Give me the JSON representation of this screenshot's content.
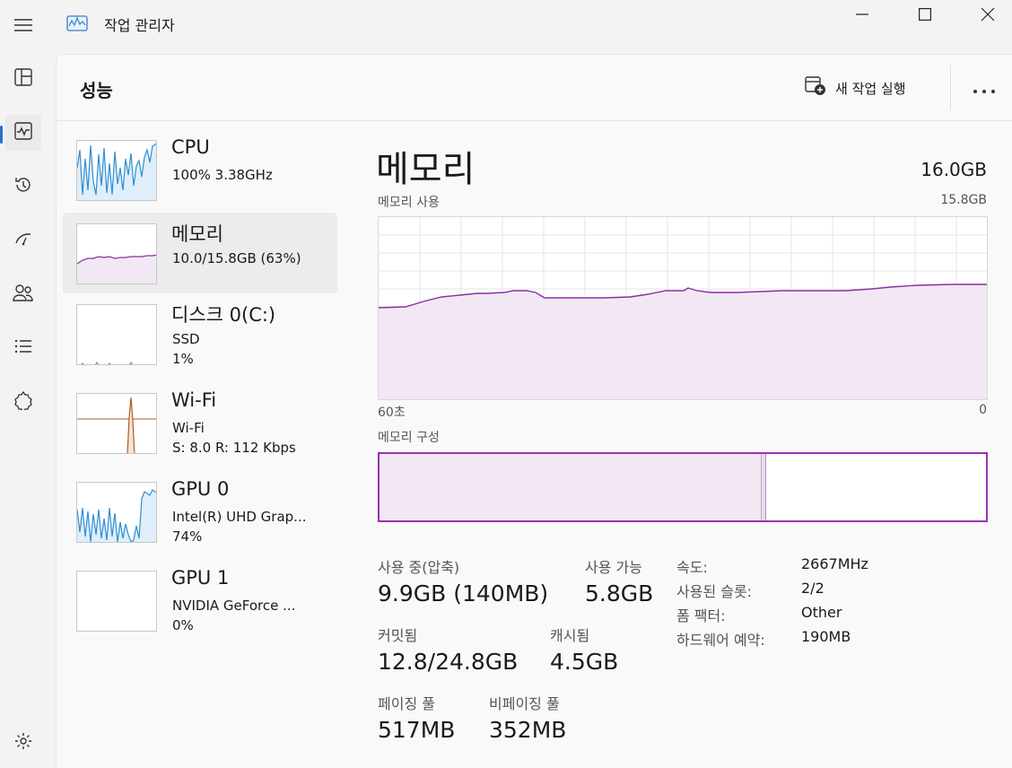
{
  "app": {
    "title": "작업 관리자"
  },
  "header": {
    "title": "성능",
    "new_task": "새 작업 실행"
  },
  "nav": {
    "icons": [
      "hamburger-icon",
      "processes-icon",
      "performance-icon",
      "app-history-icon",
      "startup-icon",
      "users-icon",
      "details-icon",
      "services-icon",
      "settings-icon"
    ]
  },
  "resources": [
    {
      "name": "CPU",
      "line1": "100% 3.38GHz",
      "line2": "",
      "line3": "",
      "color": "#2f8ed1"
    },
    {
      "name": "메모리",
      "line1": "10.0/15.8GB (63%)",
      "line2": "",
      "line3": "",
      "color": "#8b2f9e"
    },
    {
      "name": "디스크 0(C:)",
      "line1": "SSD",
      "line2": "1%",
      "line3": "",
      "color": "#5fb340"
    },
    {
      "name": "Wi-Fi",
      "line1": "Wi-Fi",
      "line2": "S: 8.0 R: 112 Kbps",
      "line3": "",
      "color": "#b55a1d"
    },
    {
      "name": "GPU 0",
      "line1": "Intel(R) UHD Grap...",
      "line2": "74%",
      "line3": "",
      "color": "#2f8ed1"
    },
    {
      "name": "GPU 1",
      "line1": "NVIDIA GeForce ...",
      "line2": "0%",
      "line3": "",
      "color": "#2f8ed1"
    }
  ],
  "detail": {
    "title": "메모리",
    "total": "16.0GB",
    "usage_label": "메모리 사용",
    "usage_max": "15.8GB",
    "time_left": "60초",
    "time_right": "0",
    "composition_label": "메모리 구성",
    "stats": {
      "in_use_label": "사용 중(압축)",
      "in_use_value": "9.9GB (140MB)",
      "available_label": "사용 가능",
      "available_value": "5.8GB",
      "committed_label": "커밋됨",
      "committed_value": "12.8/24.8GB",
      "cached_label": "캐시됨",
      "cached_value": "4.5GB",
      "paged_label": "페이징 풀",
      "paged_value": "517MB",
      "nonpaged_label": "비페이징 풀",
      "nonpaged_value": "352MB"
    },
    "specs": [
      {
        "label": "속도:",
        "value": "2667MHz"
      },
      {
        "label": "사용된 슬롯:",
        "value": "2/2"
      },
      {
        "label": "폼 팩터:",
        "value": "Other"
      },
      {
        "label": "하드웨어 예약:",
        "value": "190MB"
      }
    ]
  },
  "colors": {
    "memory": "#8b2f9e",
    "memory_fill": "#f1e8f3",
    "accent": "#2b6fd6"
  }
}
